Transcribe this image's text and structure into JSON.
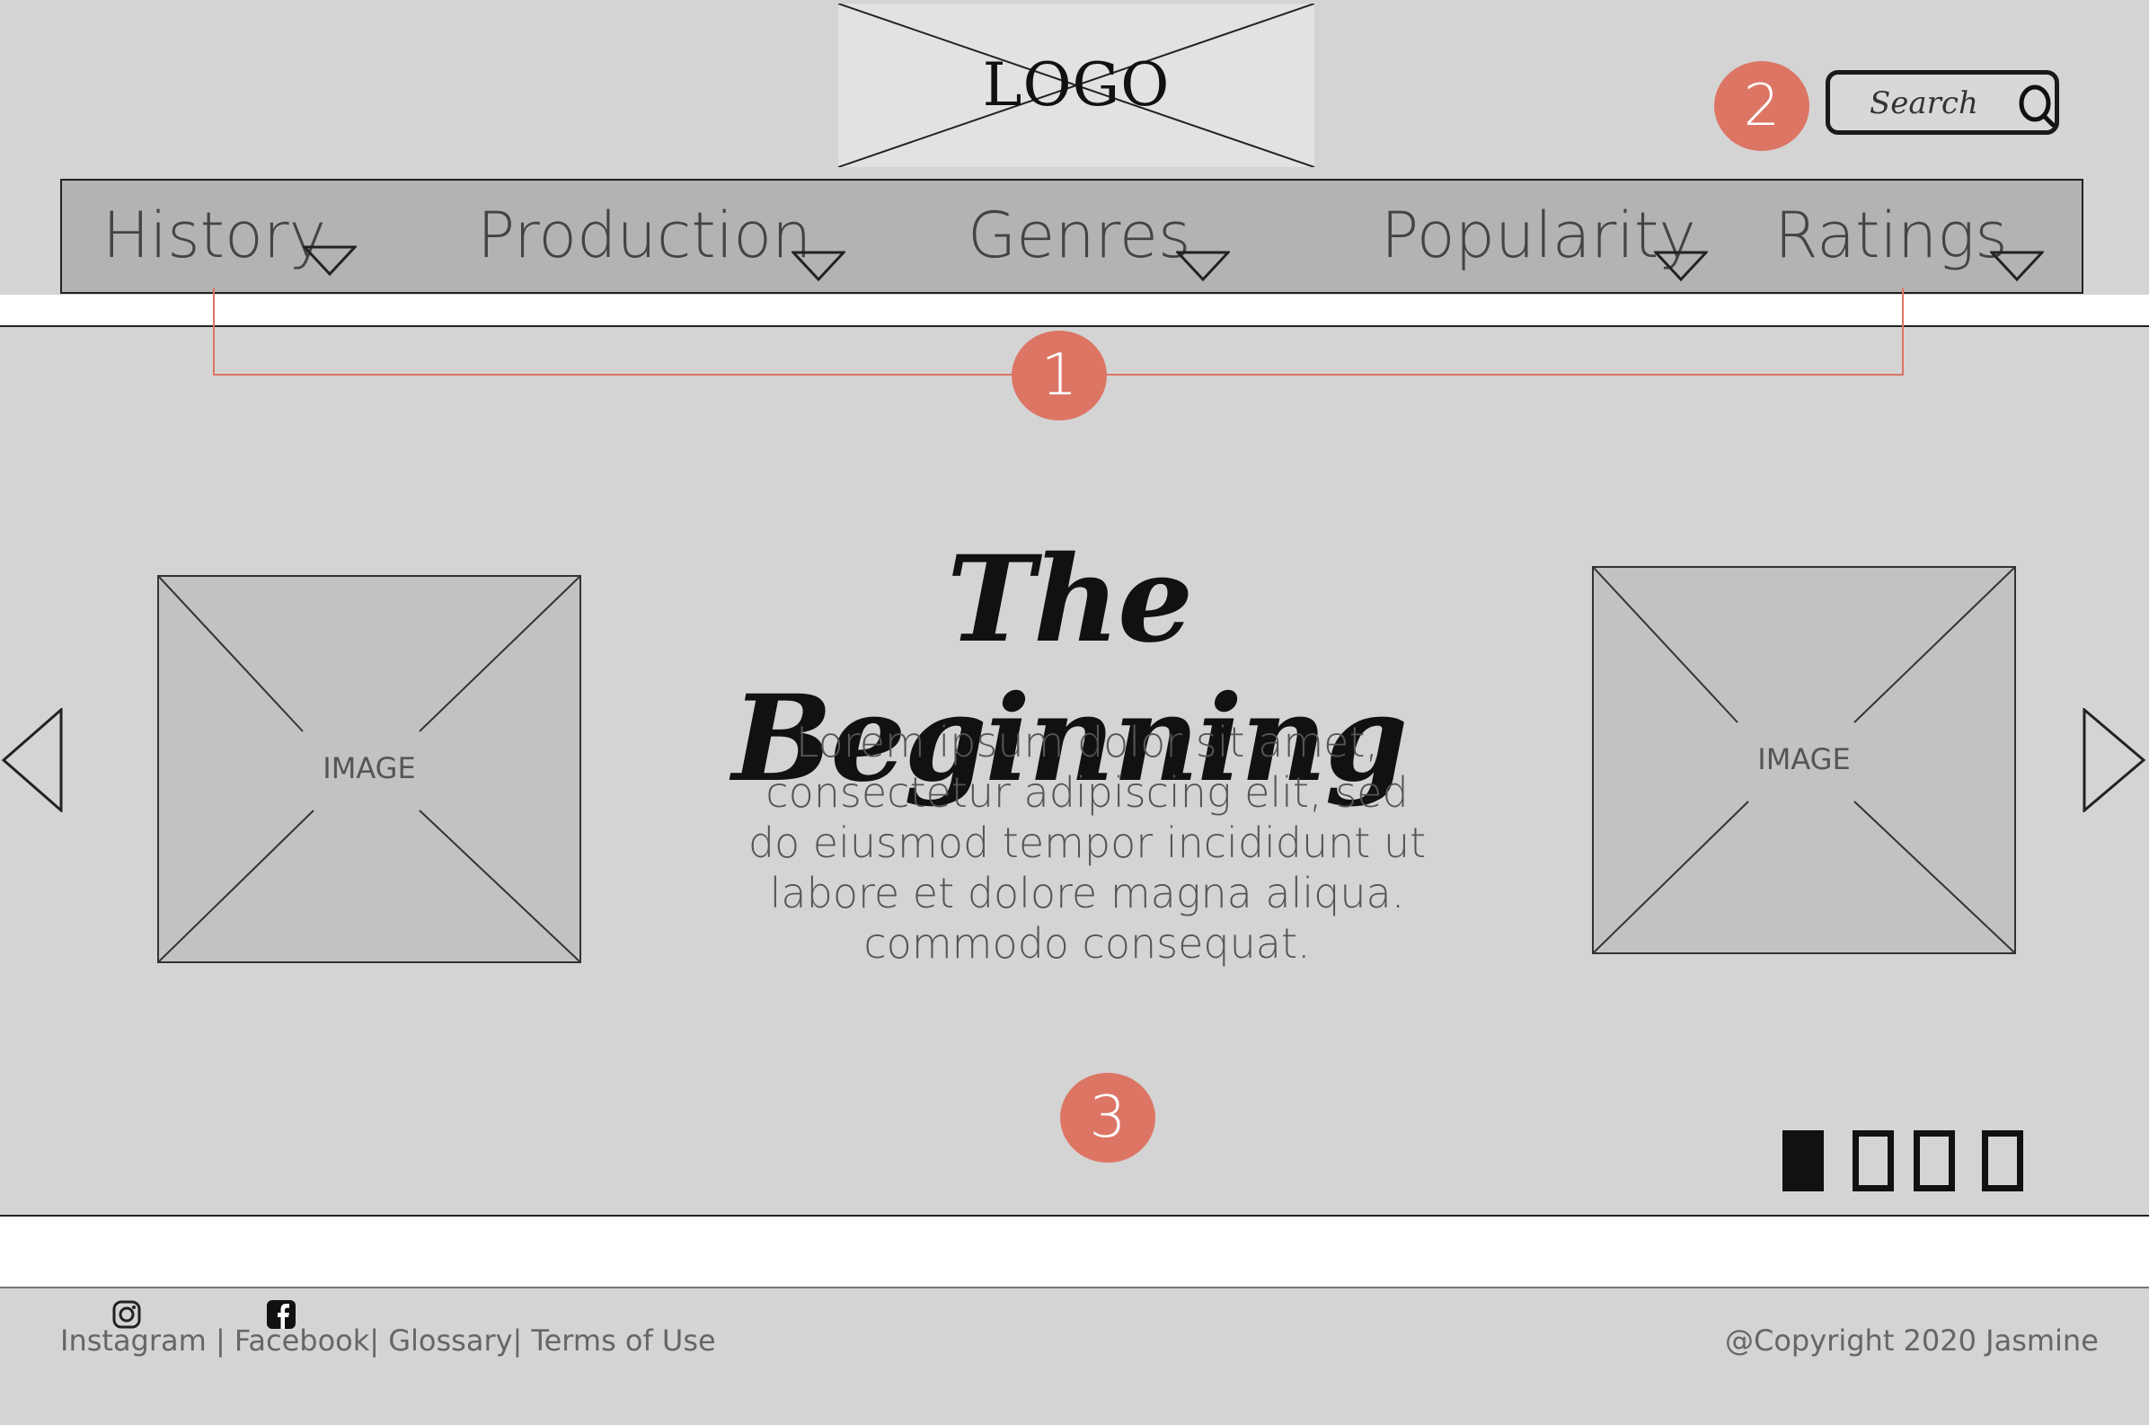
{
  "header": {
    "logo_text": "LOGO",
    "search_placeholder": "Search"
  },
  "nav": {
    "items": [
      {
        "label": "History"
      },
      {
        "label": "Production"
      },
      {
        "label": "Genres"
      },
      {
        "label": "Popularity"
      },
      {
        "label": "Ratings"
      }
    ]
  },
  "annotations": [
    "1",
    "2",
    "3"
  ],
  "hero": {
    "title": "The Beginning",
    "body": "Lorem ipsum dolor sit amet, consectetur adipiscing elit, sed do eiusmod tempor incididunt ut labore et dolore magna aliqua. commodo consequat.",
    "left_image_label": "IMAGE",
    "right_image_label": "IMAGE",
    "slides_total": 4,
    "active_slide": 1
  },
  "footer": {
    "links": [
      "Instagram",
      "Facebook",
      "Glossary",
      "Terms of Use"
    ],
    "copyright": "@Copyright 2020 Jasmine"
  },
  "colors": {
    "annotation": "#dd7565",
    "background": "#d4d4d4",
    "nav_bg": "#b3b3b3"
  }
}
